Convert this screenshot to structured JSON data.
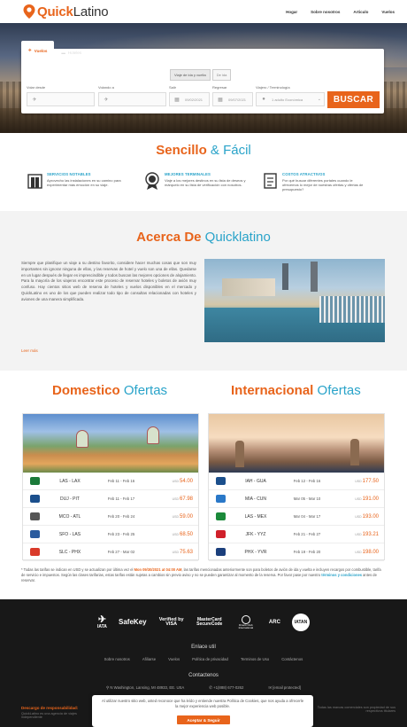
{
  "brand": {
    "name_a": "Quick",
    "name_b": "Latino",
    "accent": "#e8641b",
    "link_color": "#29a3c9"
  },
  "nav": {
    "items": [
      "Hogar",
      "Sobre nosotros",
      "Articulo",
      "Vuelos"
    ]
  },
  "search": {
    "tabs": [
      {
        "label": "Vuelos",
        "icon": "plane-icon"
      },
      {
        "label": "Hoteles",
        "icon": "bed-icon"
      }
    ],
    "trip_types": [
      "Viaje de ida y vuelta",
      "De ida"
    ],
    "fields": {
      "from_label": "Volar desde",
      "to_label": "Volando a",
      "depart_label": "Salir",
      "return_label": "Regresar",
      "travelers_label": "Viajero / Terminología",
      "depart_value": "09/02/2021",
      "return_value": "09/07/2021",
      "travelers_value": "1 adulto Económica"
    },
    "button_label": "BUSCAR"
  },
  "simple": {
    "title_a": "Sencillo",
    "title_b": " & Fácil",
    "features": [
      {
        "title": "SERVICIOS NOTABLES",
        "desc": "Aprovecho las instalaciones en su camino para experimentar más emoción en su viaje.",
        "icon": "door-icon"
      },
      {
        "title": "MEJORES TERMINALES",
        "desc": "Viaje a los mejores destinos en su lista de deseos y márquelo en su lista de verificación con nosotros.",
        "icon": "medal-icon"
      },
      {
        "title": "COSTOS ATRACTIVOS",
        "desc": "Por qué buscar diferentes portales cuando le ofrecemos lo mejor de nuestras ofertas y ofertas de presupuesto?",
        "icon": "price-tag-icon"
      }
    ]
  },
  "about": {
    "title_a": "Acerca De",
    "title_b": " Quicklatino",
    "text": "Siempre que planifique un viaje a su destino favorito, considere hacer muchas cosas que son muy importantes sin ignorar ninguna de ellas, y las reservas de hotel y vuelo son una de ellas. Quedarse en un lugar después de llegar es imprescindible y todos buscan las mejores opciones de alojamiento. Para la mayoría de los viajeros encontrar este proceso de reservar hoteles y boletos de avión muy confuso. Hay cientos sitios web de reserva de hoteles y vuelos disponibles en el mercado y QuickLatino es uno de los que pueden realizar todo tipo de consultas relacionadas con hoteles y aviones de una manera simplificada.",
    "more": "Leer más"
  },
  "offers": {
    "domestic_title_a": "Domestico",
    "domestic_title_b": " Ofertas",
    "intl_title_a": "Internacional",
    "intl_title_b": " Ofertas",
    "currency": "USD",
    "domestic": [
      {
        "route": "LAS - LAX",
        "dates": "Feb 11 - Feb 16",
        "price": "54.00",
        "airline_color": "#1b7a3a"
      },
      {
        "route": "DUJ - PIT",
        "dates": "Feb 11 - Feb 17",
        "price": "67.98",
        "airline_color": "#1b4f8c"
      },
      {
        "route": "MCO - ATL",
        "dates": "Feb 20 - Feb 24",
        "price": "59.00",
        "airline_color": "#555555"
      },
      {
        "route": "SFO - LAS",
        "dates": "Feb 23 - Feb 25",
        "price": "68.50",
        "airline_color": "#2a5b9e"
      },
      {
        "route": "SLC - PHX",
        "dates": "Feb 27 - Mar 02",
        "price": "75.63",
        "airline_color": "#d93a2a"
      }
    ],
    "international": [
      {
        "route": "IAH - GUA",
        "dates": "Feb 12 - Feb 16",
        "price": "177.50",
        "airline_color": "#1b4f8c"
      },
      {
        "route": "MIA - CUN",
        "dates": "Mar 05 - Mar 10",
        "price": "191.00",
        "airline_color": "#2a78c8"
      },
      {
        "route": "LAS - MEX",
        "dates": "Mar 04 - Mar 17",
        "price": "193.00",
        "airline_color": "#1b8a3a"
      },
      {
        "route": "JFK - YYZ",
        "dates": "Feb 21 - Feb 27",
        "price": "193.21",
        "airline_color": "#d0202a"
      },
      {
        "route": "PHX - YVR",
        "dates": "Feb 19 - Feb 20",
        "price": "198.00",
        "airline_color": "#1b3f7c"
      }
    ],
    "note_a": "* Todas las tarifas se indican en USD y se actualizan por última vez el ",
    "note_date": "Mon 09/30/2021 at 04:00 AM",
    "note_b": ", las tarifas mencionadas anteriormente son para boletos de avión de ida y vuelta e incluyen recargos por combustible, tarifa de servicio e impuestos. Según las clases tarifarias, estas tarifas están sujetas a cambios sin previo aviso y no se pueden garantizar al momento de la reserva. Por favor pase por nuestro ",
    "note_link": "términos y condiciones",
    "note_c": " antes de reservar."
  },
  "footer": {
    "badges": [
      {
        "label": "IATA",
        "icon": "iata-logo"
      },
      {
        "label": "SafeKey",
        "icon": "safekey-logo"
      },
      {
        "label": "Verified by VISA",
        "icon": "visa-verified-logo"
      },
      {
        "label": "MasterCard SecureCode",
        "icon": "mastercard-securecode-logo"
      },
      {
        "label": "Diners Club International",
        "icon": "diners-club-logo"
      },
      {
        "label": "ARC",
        "icon": "arc-logo"
      },
      {
        "label": "IATAN",
        "icon": "iatan-logo"
      }
    ],
    "links_title": "Enlace util",
    "links": [
      "Sobre nosotros",
      "Afiliarse",
      "Vuelos",
      "Política de privacidad",
      "Terminos de Uso",
      "Contáctenos"
    ],
    "contact_title": "Contactenos",
    "address": "N Washington, Lansing, MI 48933, EE. USA",
    "phone": "+1(888) 677-0262",
    "email": "[email protected]",
    "disclaimer_title": "Descargo de responsabilidad:",
    "disclaimer_text": "QuickLatino es una agencia de viajes independiente",
    "disclaimer_right": "Todas las marcas comerciales son propiedad de sus respectivos titulares"
  },
  "cookie": {
    "text": "Al utilizar nuestro sitio web, usted reconoce que ha leído y entiende nuestra Política de Cookies, que nos ayuda a ofrecerle la mejor experiencia web posible.",
    "button": "Aceptar & Seguir"
  }
}
